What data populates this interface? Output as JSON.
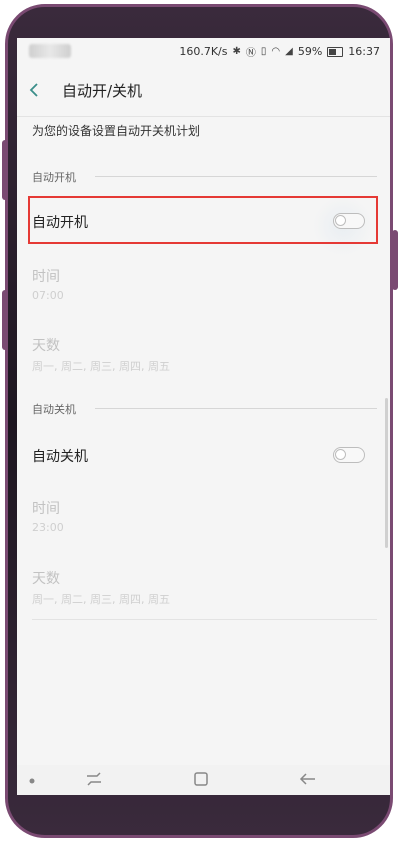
{
  "status": {
    "speed": "160.7K/s",
    "battery_percent": "59%",
    "time": "16:37",
    "icons": [
      "bluetooth-icon",
      "nfc-icon",
      "vibrate-icon",
      "wifi-icon",
      "signal-icon",
      "battery-icon"
    ]
  },
  "header": {
    "title": "自动开/关机"
  },
  "description": "为您的设备设置自动开关机计划",
  "power_on": {
    "section_label": "自动开机",
    "toggle_label": "自动开机",
    "enabled": false,
    "time_label": "时间",
    "time_value": "07:00",
    "days_label": "天数",
    "days_value": "周一, 周二, 周三, 周四, 周五"
  },
  "power_off": {
    "section_label": "自动关机",
    "toggle_label": "自动关机",
    "enabled": false,
    "time_label": "时间",
    "time_value": "23:00",
    "days_label": "天数",
    "days_value": "周一, 周二, 周三, 周四, 周五"
  },
  "colors": {
    "accent": "#3b8e8a",
    "highlight": "#e53935"
  }
}
